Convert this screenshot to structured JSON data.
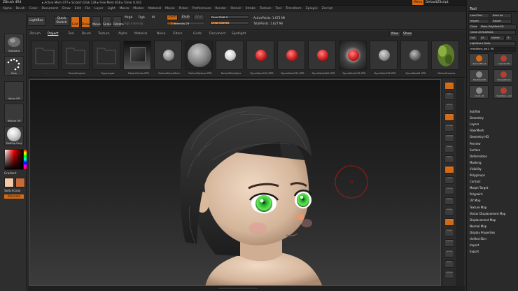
{
  "app": {
    "title": "ZBrush 4R4",
    "title_info": "▸ Active Mem 477 ▸ Scratch Disk 139 ▸ Free Mem 828 ▸ Timer 0.031",
    "menu_label": "Menu",
    "default_script": "DefaultZScript"
  },
  "menubar": [
    "Alpha",
    "Brush",
    "Color",
    "Document",
    "Draw",
    "Edit",
    "File",
    "Layer",
    "Light",
    "Macro",
    "Marker",
    "Material",
    "Movie",
    "Picker",
    "Preferences",
    "Render",
    "Stencil",
    "Stroke",
    "Texture",
    "Tool",
    "Transform",
    "Zplugin",
    "Zscript"
  ],
  "topshelf": {
    "projection_master": "Projection Master",
    "lightbox": "LightBox",
    "quick_sketch": "Quick Sketch",
    "tools": [
      "Edit",
      "Draw",
      "Move",
      "Scale",
      "Rotate"
    ],
    "mrgb": "Mrgb",
    "rgb": "Rgb",
    "m": "M",
    "rgb_intensity": "Rgb Intensity",
    "zadd": "Zadd",
    "zsub": "Zsub",
    "zcut": "Zcut",
    "z_intensity": "Z Intensity 25",
    "focal_shift": "Focal Shift 0",
    "draw_size": "Draw Size 64",
    "active_points": "ActivePoints: 1.673 Mil",
    "total_points": "TotalPoints: 1.827 Mil",
    "z_intensity_fill": 0.25,
    "draw_size_fill": 0.5
  },
  "lefttray": {
    "standard": "Standard",
    "dots": "Dots",
    "alpha_off": "Alpha Off",
    "texture_off": "Texture Off",
    "matcap": "MatCap Gray",
    "gradient": "Gradient",
    "switch_color": "SwitchColor",
    "alternate": "Alternate"
  },
  "lightbox": {
    "tabs": [
      "Zbrush",
      "Project",
      "Tool",
      "Brush",
      "Texture",
      "Alpha",
      "Material",
      "Noise",
      "Filters",
      "Grids",
      "Document",
      "Spotlight"
    ],
    "active_tab": "Project",
    "new": "New",
    "show": "Show",
    "items": [
      {
        "label": "..",
        "kind": "folder"
      },
      {
        "label": "DemoProjects",
        "kind": "folder"
      },
      {
        "label": "Hyperspab",
        "kind": "folder"
      },
      {
        "label": "DefaultCube.ZPR",
        "kind": "cube"
      },
      {
        "label": "DefaultDynaMesh",
        "kind": "gray"
      },
      {
        "label": "DefaultSphere.ZPR",
        "kind": "bigsphere"
      },
      {
        "label": "DefaultPolySphe",
        "kind": "white"
      },
      {
        "label": "DynaMesh016.ZPR",
        "kind": "red"
      },
      {
        "label": "DynaMesh032.ZPR",
        "kind": "red"
      },
      {
        "label": "DynaMesh064.ZPR",
        "kind": "red"
      },
      {
        "label": "DynaMesh128.ZPR",
        "kind": "redglow"
      },
      {
        "label": "DynaWax128.ZPR",
        "kind": "gray"
      },
      {
        "label": "DynaWax64.ZPR",
        "kind": "darkgray"
      },
      {
        "label": "DefaultLeaves",
        "kind": "plant"
      }
    ]
  },
  "rightshelf": [
    "BPR",
    "SPix",
    "Scroll",
    "Zoom",
    "Actual",
    "AAHalf",
    "Persp",
    "Floor",
    "Local",
    "Lsym",
    "Frame",
    "Move",
    "Scale",
    "Rotate",
    "PolyF",
    "Transp",
    "Ghost",
    "Solo",
    "Xpose"
  ],
  "toolpanel": {
    "tool_title": "Tool",
    "buttons": [
      [
        "Load Tool",
        "Save As"
      ],
      [
        "Import",
        "Export"
      ],
      [
        "Clone",
        "Make PolyMesh3D"
      ],
      [
        "GoZ",
        "All",
        "Visible",
        "R"
      ]
    ],
    "clone_all": "Clone All SubTools",
    "lightbox_tools": "Lightbox ▸ Tools",
    "current_tool": "maskface_ow1. 98",
    "thumbs": [
      "SphereBrush",
      "Cylinder3D",
      "PolyMesh3D",
      "SimpleBrush",
      "mesh_01",
      "maskface_ow1"
    ],
    "subpalettes": [
      "SubTool",
      "Geometry",
      "Layers",
      "FiberMesh",
      "Geometry HD",
      "Preview",
      "Surface",
      "Deformation",
      "Masking",
      "Visibility",
      "Polygroups",
      "Contact",
      "Morph Target",
      "Polypaint",
      "UV Map",
      "Texture Map",
      "Vector Displacement Map",
      "Displacement Map",
      "Normal Map",
      "Display Properties",
      "Unified Skin",
      "Import",
      "Export"
    ]
  },
  "colors": {
    "accent": "#d56a14",
    "primary_swatch": "#f3c9a8",
    "secondary_swatch": "#c76b3a",
    "brush_cursor": "#a01b1b"
  }
}
